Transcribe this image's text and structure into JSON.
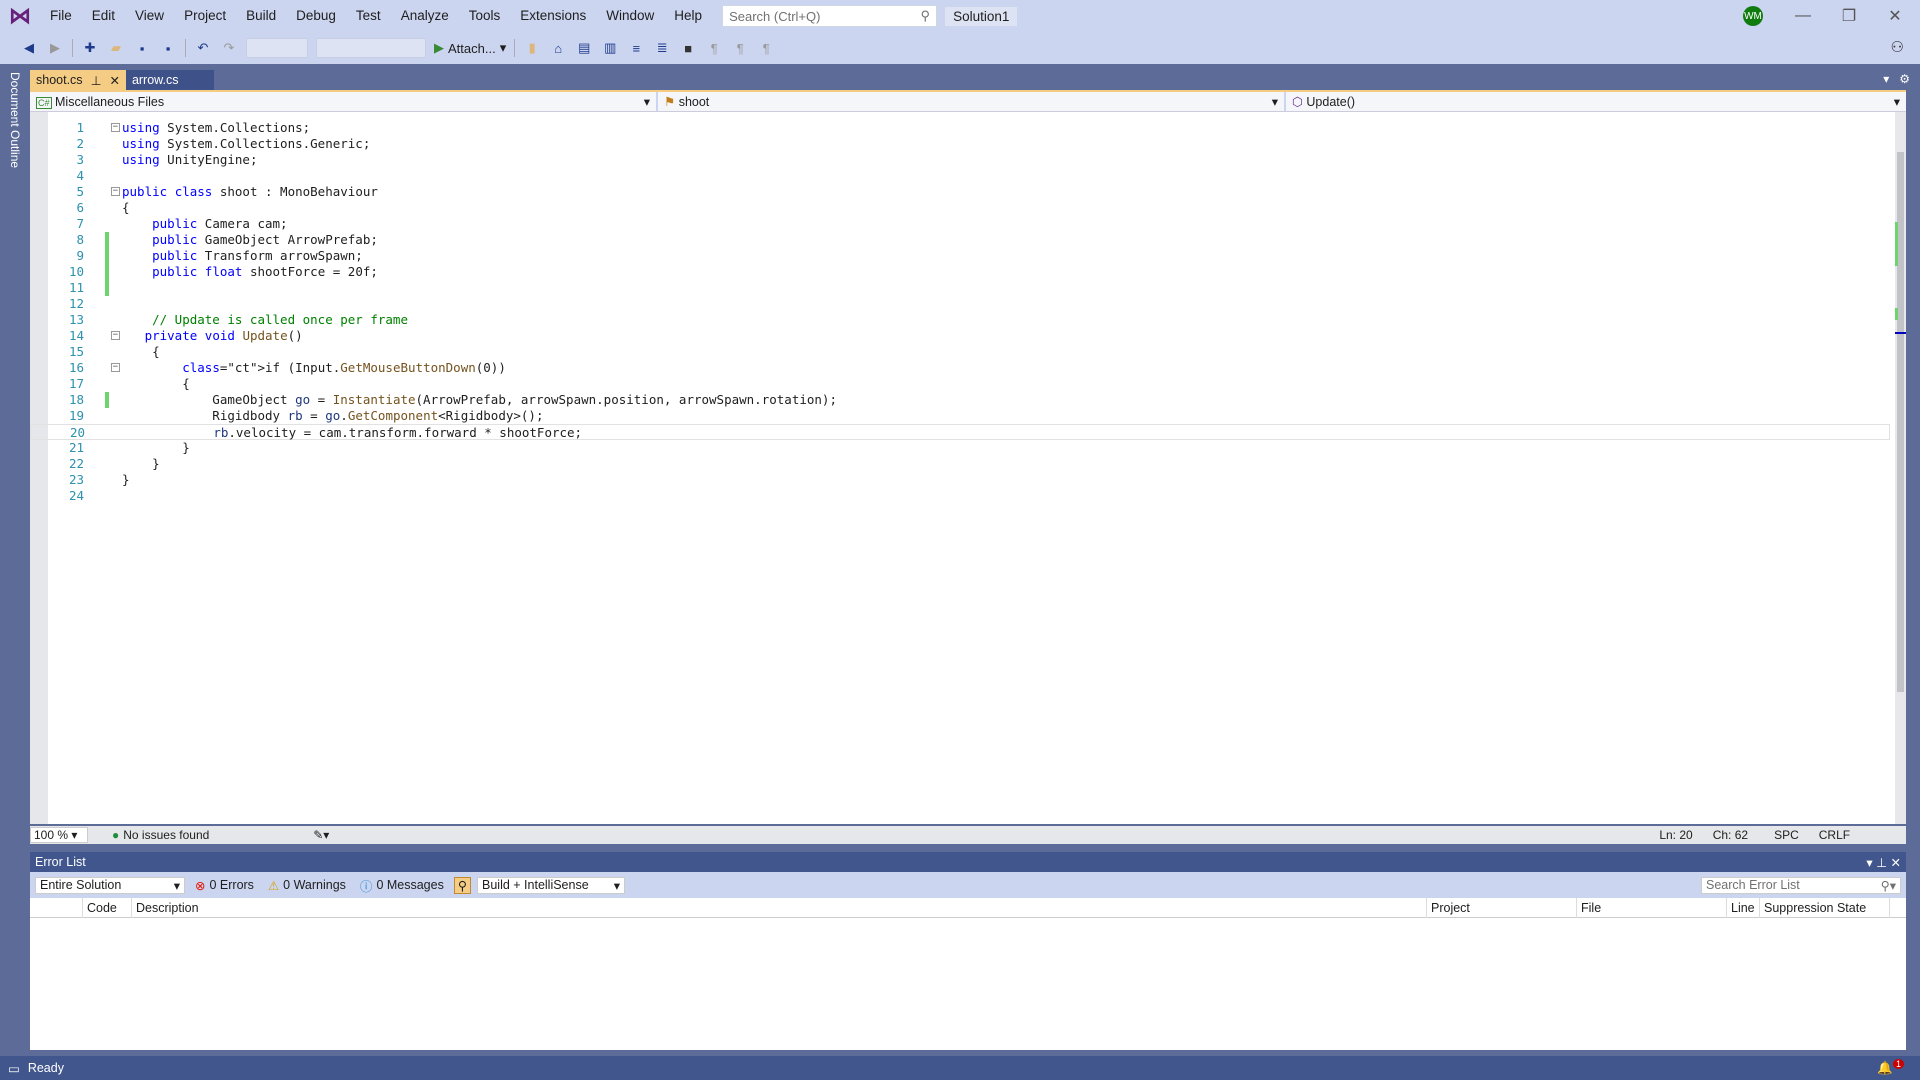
{
  "app": {
    "solution_name": "Solution1",
    "user_initials": "WM"
  },
  "menu": [
    "File",
    "Edit",
    "View",
    "Project",
    "Build",
    "Debug",
    "Test",
    "Analyze",
    "Tools",
    "Extensions",
    "Window",
    "Help"
  ],
  "search": {
    "placeholder": "Search (Ctrl+Q)"
  },
  "toolbar": {
    "attach_label": "Attach..."
  },
  "sidebar": {
    "document_outline": "Document Outline"
  },
  "tabs": [
    {
      "label": "shoot.cs",
      "active": true
    },
    {
      "label": "arrow.cs",
      "active": false
    }
  ],
  "navbar": {
    "project": "Miscellaneous Files",
    "type": "shoot",
    "member": "Update()"
  },
  "editor": {
    "lines": [
      "using System.Collections;",
      "using System.Collections.Generic;",
      "using UnityEngine;",
      "",
      "public class shoot : MonoBehaviour",
      "{",
      "    public Camera cam;",
      "    public GameObject ArrowPrefab;",
      "    public Transform arrowSpawn;",
      "    public float shootForce = 20f;",
      "",
      "",
      "    // Update is called once per frame",
      "   private void Update()",
      "    {",
      "        if (Input.GetMouseButtonDown(0))",
      "        {",
      "            GameObject go = Instantiate(ArrowPrefab, arrowSpawn.position, arrowSpawn.rotation);",
      "            Rigidbody rb = go.GetComponent<Rigidbody>();",
      "            rb.velocity = cam.transform.forward * shootForce;",
      "        }",
      "    }",
      "}",
      ""
    ],
    "changed_lines": [
      8,
      9,
      10,
      11,
      18
    ],
    "fold_lines": [
      1,
      5,
      14,
      16
    ],
    "current_line": 20
  },
  "editor_status": {
    "zoom": "100 %",
    "issues": "No issues found",
    "line": "Ln: 20",
    "col": "Ch: 62",
    "whitespace": "SPC",
    "line_ending": "CRLF"
  },
  "error_list": {
    "title": "Error List",
    "scope": "Entire Solution",
    "errors": "0 Errors",
    "warnings": "0 Warnings",
    "messages": "0 Messages",
    "source": "Build + IntelliSense",
    "search_placeholder": "Search Error List",
    "columns": [
      "Code",
      "Description",
      "Project",
      "File",
      "Line",
      "Suppression State"
    ]
  },
  "status": {
    "text": "Ready",
    "notifications": "1"
  }
}
